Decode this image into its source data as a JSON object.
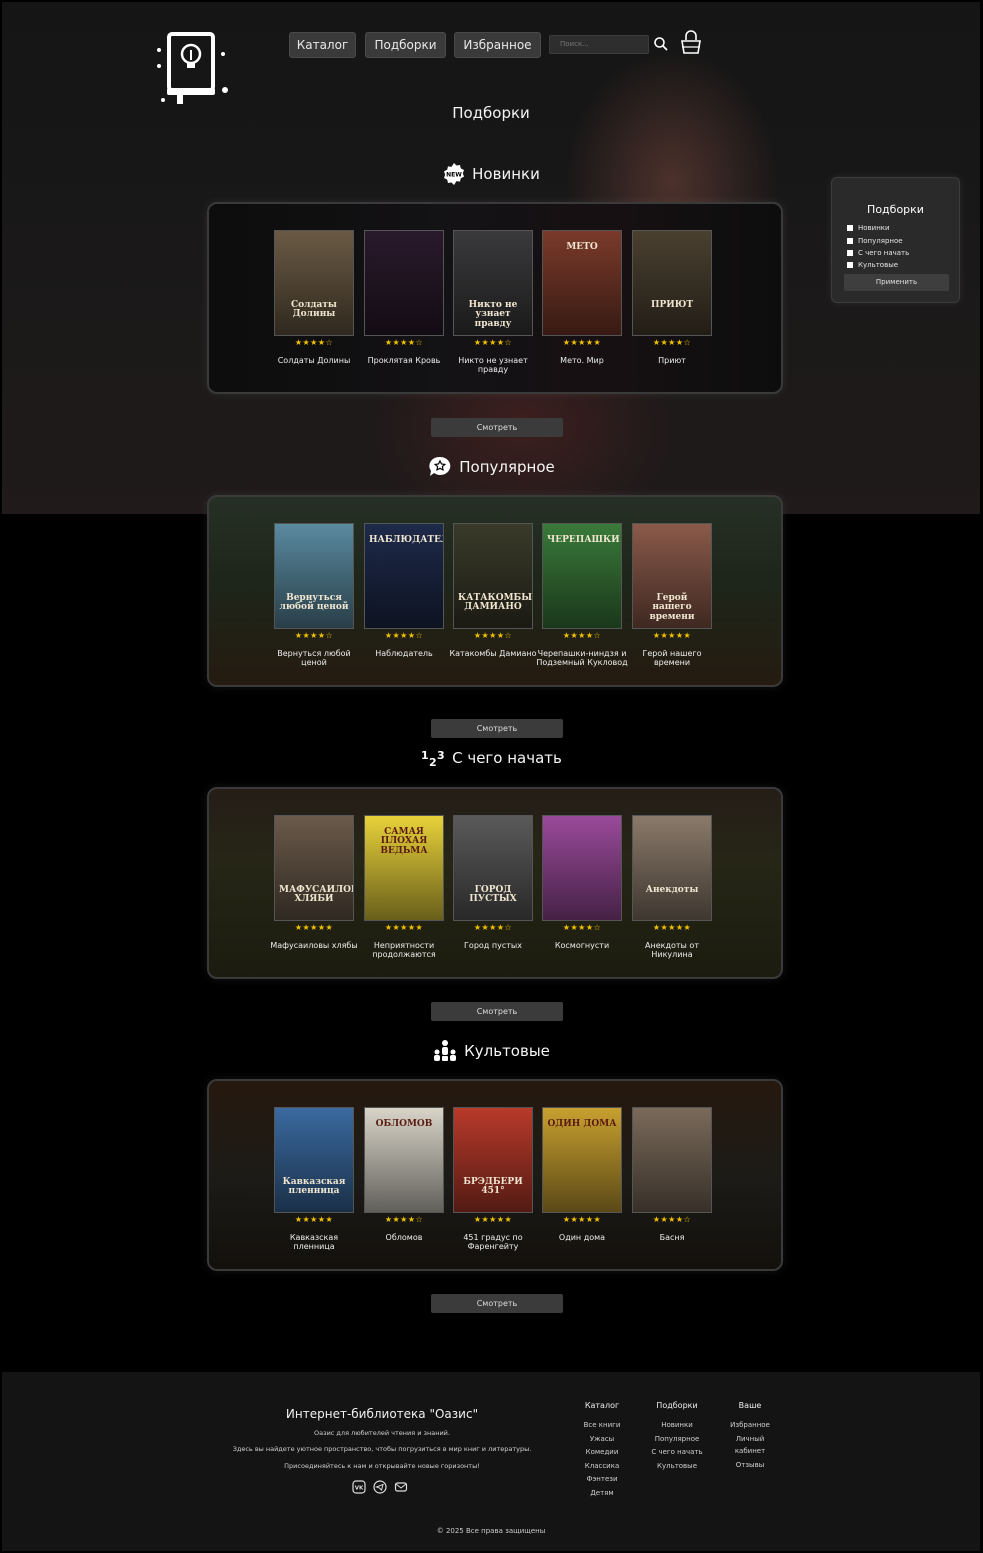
{
  "header": {
    "nav": [
      "Каталог",
      "Подборки",
      "Избранное"
    ],
    "search_placeholder": "Поиск..."
  },
  "page_title": "Подборки",
  "sections": [
    {
      "title": "Новинки",
      "icon": "new-badge-icon",
      "button": "Смотреть",
      "books": [
        {
          "title": "Солдаты Долины",
          "stars": "★★★★☆",
          "cover_text": "Солдаты Долины",
          "cover_color": "#6a5a44"
        },
        {
          "title": "Проклятая Кровь",
          "stars": "★★★★☆",
          "cover_text": "",
          "cover_color": "#2a1a2c"
        },
        {
          "title": "Никто не узнает правду",
          "stars": "★★★★☆",
          "cover_text": "Никто не узнает правду",
          "cover_color": "#3a3a3c"
        },
        {
          "title": "Мето. Мир",
          "stars": "★★★★★",
          "cover_text": "МЕТО",
          "cover_color": "#7a3a2a"
        },
        {
          "title": "Приют",
          "stars": "★★★★☆",
          "cover_text": "ПРИЮТ",
          "cover_color": "#4a4030"
        }
      ]
    },
    {
      "title": "Популярное",
      "icon": "star-bubble-icon",
      "button": "Смотреть",
      "books": [
        {
          "title": "Вернуться любой ценой",
          "stars": "★★★★☆",
          "cover_text": "Вернуться любой ценой",
          "cover_color": "#5a8aa0"
        },
        {
          "title": "Наблюдатель",
          "stars": "★★★★☆",
          "cover_text": "НАБЛЮДАТЕЛЬ",
          "cover_color": "#1e2a4a"
        },
        {
          "title": "Катакомбы Дамиано",
          "stars": "★★★★☆",
          "cover_text": "КАТАКОМБЫ ДАМИАНО",
          "cover_color": "#3a3a2a"
        },
        {
          "title": "Черепашки-ниндзя и Подземный Кукловод",
          "stars": "★★★★☆",
          "cover_text": "ЧЕРЕПАШКИ",
          "cover_color": "#3a7a3a"
        },
        {
          "title": "Герой нашего времени",
          "stars": "★★★★★",
          "cover_text": "Герой нашего времени",
          "cover_color": "#8a5a4a"
        }
      ]
    },
    {
      "title": "С чего начать",
      "icon": "numbers-icon",
      "button": "Смотреть",
      "books": [
        {
          "title": "Мафусаиловы хлябы",
          "stars": "★★★★★",
          "cover_text": "МАФУСАИЛОВЫ ХЛЯБИ",
          "cover_color": "#6a5a4a"
        },
        {
          "title": "Неприятности продолжаются",
          "stars": "★★★★★",
          "cover_text": "САМАЯ ПЛОХАЯ ВЕДЬМА",
          "cover_color": "#e8d23a"
        },
        {
          "title": "Город пустых",
          "stars": "★★★★☆",
          "cover_text": "ГОРОД ПУСТЫХ",
          "cover_color": "#5a5a5a"
        },
        {
          "title": "Космогнусти",
          "stars": "★★★★☆",
          "cover_text": "",
          "cover_color": "#9a4a9a"
        },
        {
          "title": "Анекдоты от Никулина",
          "stars": "★★★★★",
          "cover_text": "Анекдоты",
          "cover_color": "#8a7a6a"
        }
      ]
    },
    {
      "title": "Культовые",
      "icon": "people-icon",
      "button": "Смотреть",
      "books": [
        {
          "title": "Кавказская пленница",
          "stars": "★★★★★",
          "cover_text": "Кавказская пленница",
          "cover_color": "#3a6aa0"
        },
        {
          "title": "Обломов",
          "stars": "★★★★☆",
          "cover_text": "ОБЛОМОВ",
          "cover_color": "#d8d4c8"
        },
        {
          "title": "451 градус по Фаренгейту",
          "stars": "★★★★★",
          "cover_text": "БРЭДБЕРИ 451°",
          "cover_color": "#b83a2a"
        },
        {
          "title": "Один дома",
          "stars": "★★★★★",
          "cover_text": "ОДИН ДОМА",
          "cover_color": "#c8a030"
        },
        {
          "title": "Басня",
          "stars": "★★★★☆",
          "cover_text": "",
          "cover_color": "#7a6a5a"
        }
      ]
    }
  ],
  "sidebar": {
    "title": "Подборки",
    "items": [
      "Новинки",
      "Популярное",
      "С чего начать",
      "Культовые"
    ],
    "apply": "Применить"
  },
  "footer": {
    "title": "Интернет-библиотека \"Оазис\"",
    "lines": [
      "Оазис для любителей чтения и знаний.",
      "Здесь вы найдете уютное пространство, чтобы погрузиться в мир книг и литературы.",
      "Присоединяйтесь к нам и открывайте новые горизонты!"
    ],
    "columns": [
      {
        "title": "Каталог",
        "items": [
          "Все книги",
          "Ужасы",
          "Комедии",
          "Классика",
          "Фэнтези",
          "Детям"
        ]
      },
      {
        "title": "Подборки",
        "items": [
          "Новинки",
          "Популярное",
          "С чего начать",
          "Культовые"
        ]
      },
      {
        "title": "Ваше",
        "items": [
          "Избранное",
          "Личный кабинет",
          "Отзывы"
        ]
      }
    ],
    "copyright": "© 2025 Все права защищены"
  },
  "colors": {
    "accent_star": "#f2c200",
    "button_bg": "#3b3b3b",
    "footer_bg": "#141414"
  }
}
